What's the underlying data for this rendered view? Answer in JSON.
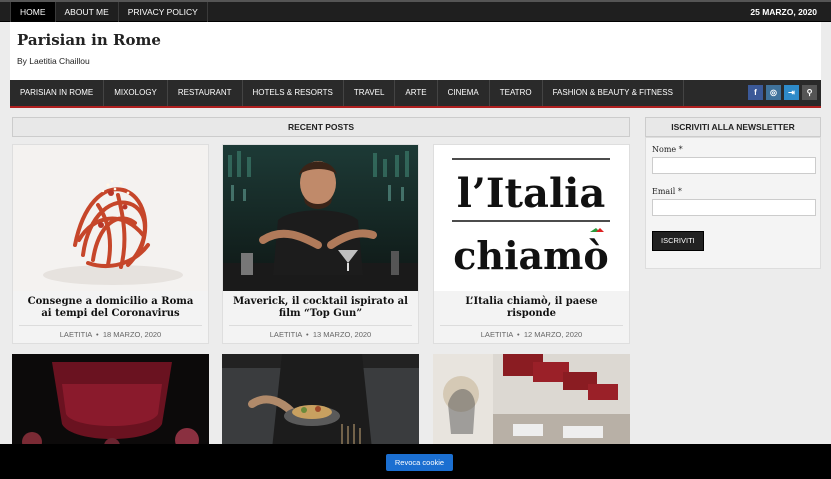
{
  "topbar": {
    "nav": [
      {
        "label": "Home",
        "active": true
      },
      {
        "label": "About me",
        "active": false
      },
      {
        "label": "Privacy Policy",
        "active": false
      }
    ],
    "date": "25 Marzo, 2020"
  },
  "site": {
    "title": "Parisian in Rome",
    "description": "By Laetitia Chaillou"
  },
  "mainnav": {
    "items": [
      "Parisian in Rome",
      "Mixology",
      "Restaurant",
      "Hotels & Resorts",
      "Travel",
      "Arte",
      "Cinema",
      "Teatro",
      "Fashion & Beauty & Fitness"
    ],
    "social": [
      {
        "icon": "facebook-icon",
        "glyph": "f"
      },
      {
        "icon": "instagram-icon",
        "glyph": "◎"
      },
      {
        "icon": "login-icon",
        "glyph": "⇥"
      },
      {
        "icon": "search-icon",
        "glyph": "⚲"
      }
    ]
  },
  "recent": {
    "heading": "Recent Posts",
    "posts": [
      {
        "title": "Consegne a domicilio a Roma ai tempi del Coronavirus",
        "author": "Laetitia",
        "date": "18 Marzo, 2020"
      },
      {
        "title": "Maverick, il cocktail ispirato al film “Top Gun”",
        "author": "Laetitia",
        "date": "13 Marzo, 2020"
      },
      {
        "title": "L’Italia chiamò, il paese risponde",
        "author": "Laetitia",
        "date": "12 Marzo, 2020"
      }
    ],
    "logo_text": {
      "line1": "l’Italia",
      "line2": "chiamò"
    }
  },
  "sidebar": {
    "heading": "Iscriviti alla newsletter",
    "name_label": "Nome *",
    "email_label": "Email *",
    "button": "Iscriviti"
  },
  "cookie": {
    "button": "Revoca cookie"
  },
  "colors": {
    "accent_red": "#b02020",
    "dark": "#1f1f1f",
    "cookie_blue": "#1b6fd1"
  }
}
